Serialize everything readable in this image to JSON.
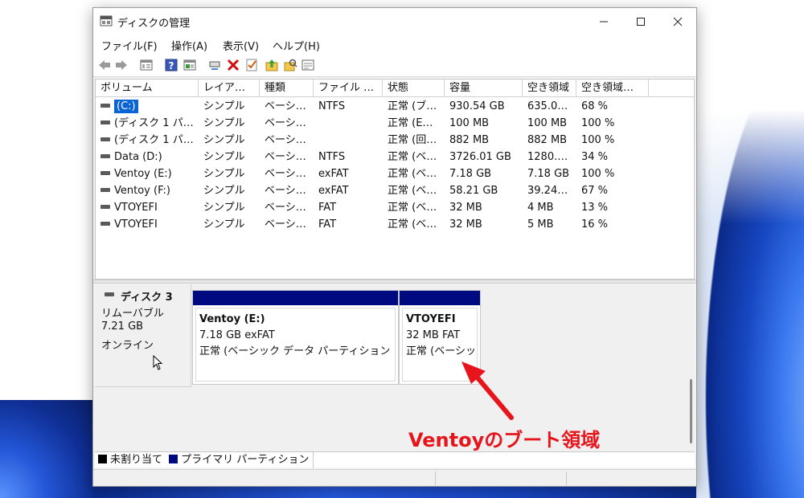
{
  "window": {
    "title": "ディスクの管理"
  },
  "menu": [
    "ファイル(F)",
    "操作(A)",
    "表示(V)",
    "ヘルプ(H)"
  ],
  "toolbar_icons": [
    "back-icon",
    "forward-icon",
    "properties-icon",
    "help-icon",
    "view-icon",
    "connect-icon",
    "delete-icon",
    "check-icon",
    "folder-up-icon",
    "search-folder-icon",
    "list-icon"
  ],
  "columns": [
    "ボリューム",
    "レイア…",
    "種類",
    "ファイル …",
    "状態",
    "容量",
    "空き領域",
    "空き領域…"
  ],
  "rows": [
    [
      "(C:)",
      "シンプル",
      "ベーシ…",
      "NTFS",
      "正常 (ブ…",
      "930.54 GB",
      "635.0…",
      "68 %"
    ],
    [
      "(ディスク 1 パ…",
      "シンプル",
      "ベーシ…",
      "",
      "正常 (E…",
      "100 MB",
      "100 MB",
      "100 %"
    ],
    [
      "(ディスク 1 パ…",
      "シンプル",
      "ベーシ…",
      "",
      "正常 (回…",
      "882 MB",
      "882 MB",
      "100 %"
    ],
    [
      "Data (D:)",
      "シンプル",
      "ベーシ…",
      "NTFS",
      "正常 (ベ…",
      "3726.01 GB",
      "1280.…",
      "34 %"
    ],
    [
      "Ventoy (E:)",
      "シンプル",
      "ベーシ…",
      "exFAT",
      "正常 (ベ…",
      "7.18 GB",
      "7.18 GB",
      "100 %"
    ],
    [
      "Ventoy (F:)",
      "シンプル",
      "ベーシ…",
      "exFAT",
      "正常 (ベ…",
      "58.21 GB",
      "39.24…",
      "67 %"
    ],
    [
      "VTOYEFI",
      "シンプル",
      "ベーシ…",
      "FAT",
      "正常 (ベ…",
      "32 MB",
      "4 MB",
      "13 %"
    ],
    [
      "VTOYEFI",
      "シンプル",
      "ベーシ…",
      "FAT",
      "正常 (ベ…",
      "32 MB",
      "5 MB",
      "16 %"
    ]
  ],
  "disk": {
    "name": "ディスク 3",
    "type": "リムーバブル",
    "size": "7.21 GB",
    "status": "オンライン"
  },
  "partitions": [
    {
      "name": "Ventoy  (E:)",
      "size": "7.18 GB exFAT",
      "status": "正常 (ベーシック データ パーティション"
    },
    {
      "name": "VTOYEFI",
      "size": "32 MB FAT",
      "status": "正常 (ベーシッ"
    }
  ],
  "legend": {
    "unallocated": "未割り当て",
    "primary": "プライマリ パーティション"
  },
  "colors": {
    "primary_bar": "#000a80",
    "annotation": "#e8141c",
    "selection": "#0a64d6"
  },
  "annotation": "Ventoyのブート領域"
}
